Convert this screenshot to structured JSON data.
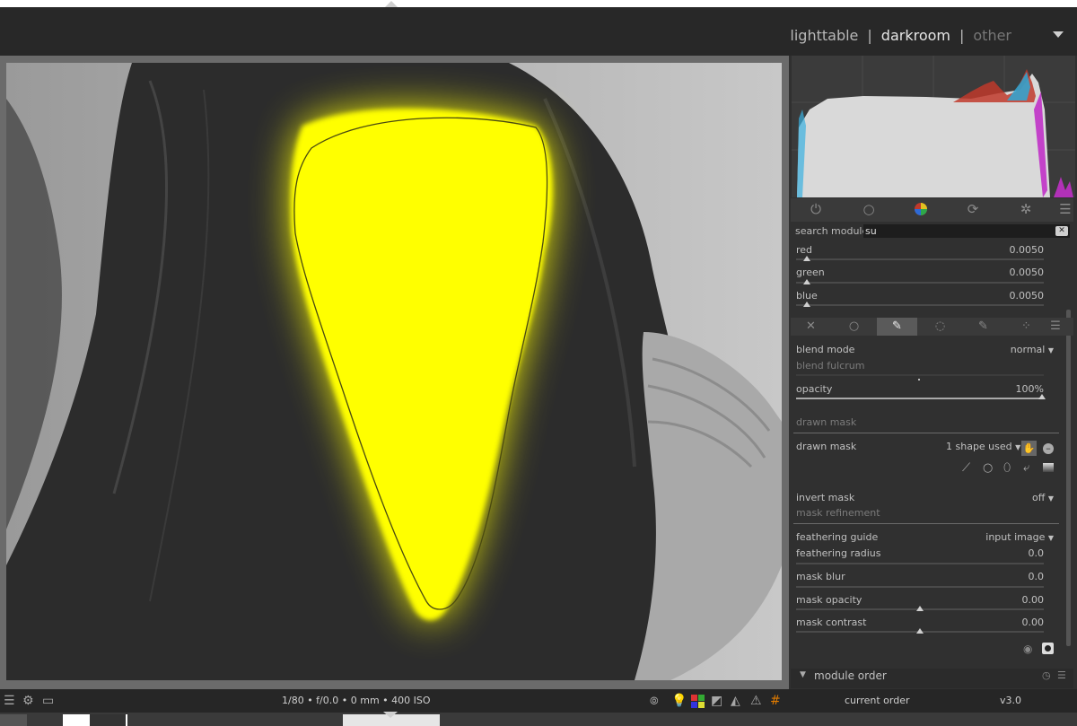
{
  "views": {
    "lighttable": "lighttable",
    "sep1": "|",
    "darkroom": "darkroom",
    "sep2": "|",
    "other": "other"
  },
  "search": {
    "label": "search module",
    "value": "su"
  },
  "rgb_sliders": [
    {
      "label": "red",
      "value": "0.0050"
    },
    {
      "label": "green",
      "value": "0.0050"
    },
    {
      "label": "blue",
      "value": "0.0050"
    }
  ],
  "blend": {
    "blend_mode_label": "blend mode",
    "blend_mode_value": "normal",
    "blend_fulcrum_label": "blend fulcrum",
    "opacity_label": "opacity",
    "opacity_value": "100%",
    "opacity_level": 1.0,
    "drawn_mask_header": "drawn mask",
    "drawn_mask_label": "drawn mask",
    "drawn_mask_value": "1 shape used",
    "invert_mask_label": "invert mask",
    "invert_mask_value": "off",
    "mask_refinement_header": "mask refinement",
    "feathering_guide_label": "feathering guide",
    "feathering_guide_value": "input image",
    "feathering_radius_label": "feathering radius",
    "feathering_radius_value": "0.0",
    "mask_blur_label": "mask blur",
    "mask_blur_value": "0.0",
    "mask_opacity_label": "mask opacity",
    "mask_opacity_value": "0.00",
    "mask_contrast_label": "mask contrast",
    "mask_contrast_value": "0.00"
  },
  "module_order": {
    "label": "module order",
    "current_label": "current order",
    "current_value": "v3.0"
  },
  "image_info": "1/80 • f/0.0 • 0 mm • 400 ISO",
  "colors": {
    "mask_yellow": "#ffff00",
    "panel_bg": "#303030",
    "accent_orange": "#e07b00"
  }
}
